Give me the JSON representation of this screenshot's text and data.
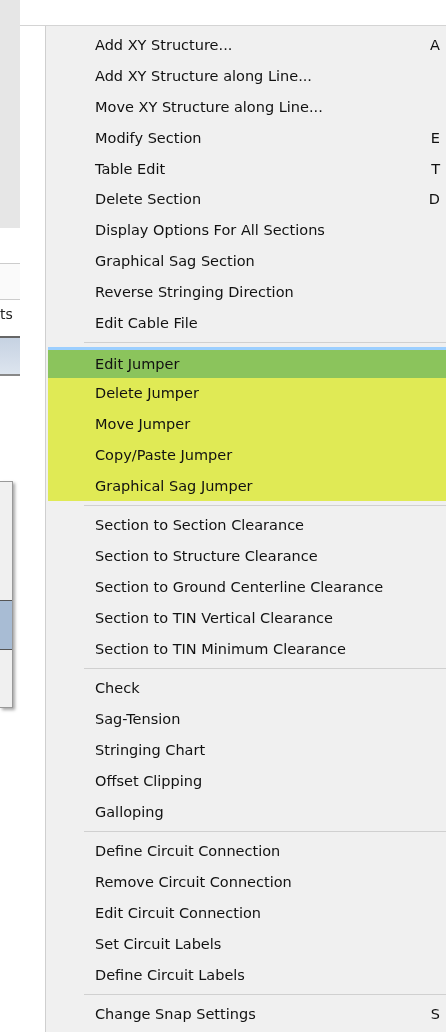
{
  "background_window": {
    "tab_fragment": "ts"
  },
  "menu": {
    "sections": [
      {
        "items": [
          {
            "label": "Add XY Structure...",
            "shortcut": "A",
            "selected": false
          },
          {
            "label": "Add XY Structure along Line...",
            "selected": false
          },
          {
            "label": "Move XY Structure along Line...",
            "selected": false
          },
          {
            "label": "Modify Section",
            "shortcut": "E",
            "selected": false
          },
          {
            "label": "Table Edit",
            "shortcut": "T",
            "selected": false
          },
          {
            "label": "Delete Section",
            "shortcut": "D",
            "selected": false
          },
          {
            "label": "Display Options For All Sections",
            "selected": false
          },
          {
            "label": "Graphical Sag Section",
            "selected": false
          },
          {
            "label": "Reverse Stringing Direction",
            "selected": false
          },
          {
            "label": "Edit Cable File",
            "selected": false
          }
        ]
      },
      {
        "items": [
          {
            "label": "Edit Jumper",
            "selected": true,
            "color": "#8bc45c"
          },
          {
            "label": "Delete Jumper",
            "selected": false,
            "color": "#e0ea55"
          },
          {
            "label": "Move Jumper",
            "selected": false,
            "color": "#e0ea55"
          },
          {
            "label": "Copy/Paste Jumper",
            "selected": false,
            "color": "#e0ea55"
          },
          {
            "label": "Graphical Sag Jumper",
            "selected": false,
            "color": "#e0ea55"
          }
        ]
      },
      {
        "items": [
          {
            "label": "Section to Section Clearance",
            "selected": false
          },
          {
            "label": "Section to Structure Clearance",
            "selected": false
          },
          {
            "label": "Section to Ground Centerline Clearance",
            "selected": false
          },
          {
            "label": "Section to TIN Vertical Clearance",
            "selected": false
          },
          {
            "label": "Section to TIN Minimum Clearance",
            "selected": false
          }
        ]
      },
      {
        "items": [
          {
            "label": "Check",
            "selected": false
          },
          {
            "label": "Sag-Tension",
            "selected": false
          },
          {
            "label": "Stringing Chart",
            "selected": false
          },
          {
            "label": "Offset Clipping",
            "selected": false
          },
          {
            "label": "Galloping",
            "selected": false
          }
        ]
      },
      {
        "items": [
          {
            "label": "Define Circuit Connection",
            "selected": false
          },
          {
            "label": "Remove Circuit Connection",
            "selected": false
          },
          {
            "label": "Edit Circuit Connection",
            "selected": false
          },
          {
            "label": "Set Circuit Labels",
            "selected": false
          },
          {
            "label": "Define Circuit Labels",
            "selected": false
          }
        ]
      },
      {
        "items": [
          {
            "label": "Change Snap Settings",
            "shortcut": "S",
            "selected": false
          }
        ]
      }
    ]
  }
}
